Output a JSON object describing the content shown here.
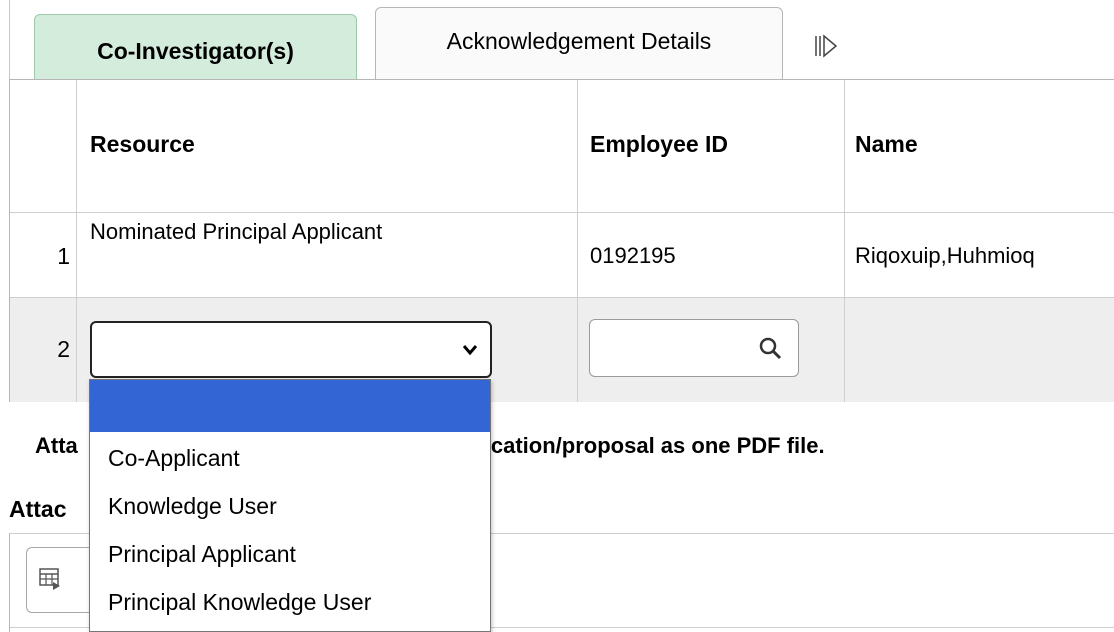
{
  "tabs": {
    "active_label": "Co-Investigator(s)",
    "second_label": "Acknowledgement Details",
    "more_icon": "show-more-tabs-icon"
  },
  "grid": {
    "headers": [
      "",
      "Resource",
      "Employee ID",
      "Name"
    ],
    "rows": [
      {
        "num": "1",
        "resource": "Nominated Principal Applicant",
        "employee_id": "0192195",
        "name": "Riqoxuip,Huhmioq"
      },
      {
        "num": "2",
        "resource": "",
        "employee_id": "",
        "name": ""
      }
    ]
  },
  "dropdown": {
    "options": [
      "",
      "Co-Applicant",
      "Knowledge User",
      "Principal Applicant",
      "Principal Knowledge User"
    ],
    "highlighted_index": 0,
    "highlight_color": "#3365d4"
  },
  "attachments": {
    "note_left": "Atta",
    "note_right": "pplication/proposal as one PDF file.",
    "heading": "Attac"
  },
  "colors": {
    "active_tab_bg": "#d4ecdc",
    "row_alt_bg": "#eeeeee"
  }
}
